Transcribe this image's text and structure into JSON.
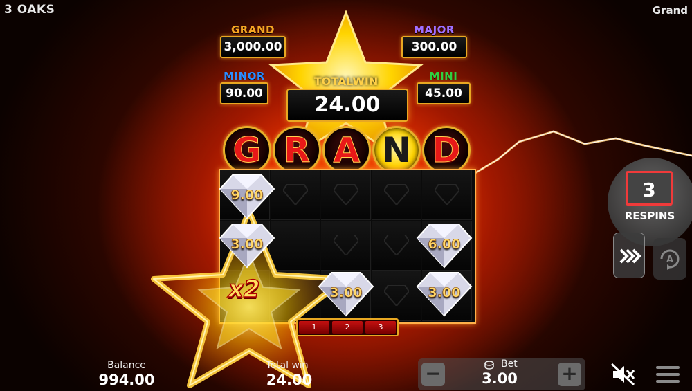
{
  "header": {
    "brand": "3 OAKS",
    "mode": "Grand"
  },
  "jackpots": {
    "grand": {
      "name": "GRAND",
      "value": "3,000.00",
      "color": "#f0a020"
    },
    "major": {
      "name": "MAJOR",
      "value": "300.00",
      "color": "#a070ff"
    },
    "minor": {
      "name": "MINOR",
      "value": "90.00",
      "color": "#2a8cff"
    },
    "mini": {
      "name": "MINI",
      "value": "45.00",
      "color": "#30d040"
    }
  },
  "total_win": {
    "label": "TOTALWIN",
    "value": "24.00"
  },
  "grand_letters": [
    "G",
    "R",
    "A",
    "N",
    "D"
  ],
  "grid": {
    "gems": [
      {
        "label": "9.00",
        "col": 0,
        "row": 0
      },
      {
        "label": "3.00",
        "col": 0,
        "row": 1
      },
      {
        "label": "6.00",
        "col": 4,
        "row": 1
      },
      {
        "label": "3.00",
        "col": 2,
        "row": 2
      },
      {
        "label": "3.00",
        "col": 4,
        "row": 2
      }
    ],
    "multiplier": "x2"
  },
  "respin_tracker": [
    "1",
    "2",
    "3"
  ],
  "respins": {
    "count": "3",
    "label": "RESPINS"
  },
  "footer": {
    "balance_label": "Balance",
    "balance_value": "994.00",
    "total_win_label": "Total win",
    "total_win_value": "24.00",
    "bet_label": "Bet",
    "bet_value": "3.00",
    "minus": "−",
    "plus": "+"
  }
}
